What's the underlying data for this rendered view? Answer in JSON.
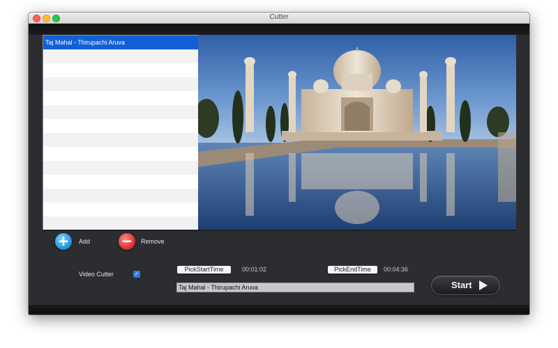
{
  "window": {
    "title": "Cutter"
  },
  "playlist": {
    "items": [
      {
        "label": "Taj Mahal - Thirupachi Aruva",
        "selected": true
      }
    ]
  },
  "video": {
    "icon": "taj-mahal-preview-image"
  },
  "controls": {
    "add_label": "Add",
    "remove_label": "Remove",
    "video_cutter_label": "Video Cutter",
    "video_cutter_checked": true,
    "pick_start_label": "PickStartTime",
    "start_time": "00:01:02",
    "pick_end_label": "PickEndTime",
    "end_time": "00:04:36",
    "filename": "Taj Mahal - Thirupachi Aruva",
    "start_label": "Start"
  },
  "colors": {
    "selection": "#1160d8",
    "add": "#1b8fd6",
    "remove": "#d72a2a",
    "window_bg": "#2b2d30"
  }
}
